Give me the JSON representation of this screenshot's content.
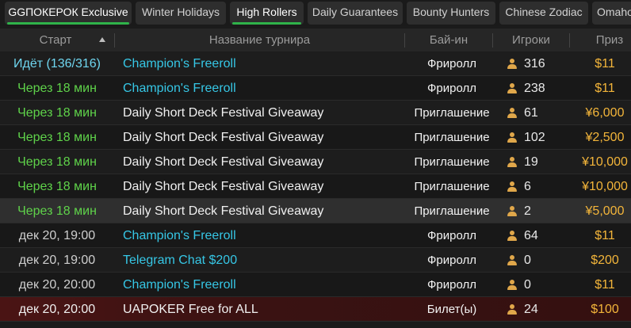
{
  "tabs": [
    {
      "label": "GGПОКЕРОК Exclusive",
      "active": true
    },
    {
      "label": "Winter Holidays",
      "active": false
    },
    {
      "label": "High Rollers",
      "active": true
    },
    {
      "label": "Daily Guarantees",
      "active": false
    },
    {
      "label": "Bounty Hunters",
      "active": false
    },
    {
      "label": "Chinese Zodiac",
      "active": false
    },
    {
      "label": "Omaho",
      "active": false
    }
  ],
  "columns": {
    "start": "Старт",
    "name": "Название турнира",
    "buyin": "Бай-ин",
    "players": "Игроки",
    "prize": "Приз"
  },
  "colors": {
    "active_tab_underline": "#2fb34a",
    "status_green": "#5fd34a",
    "name_cyan": "#36c7e6",
    "prize_gold": "#f3b53a",
    "user_icon": "#e0a74a"
  },
  "rows": [
    {
      "start": "Идёт (136/316)",
      "start_style": "live",
      "name": "Champion's Freeroll",
      "name_style": "cyan",
      "buyin": "Фриролл",
      "players": "316",
      "prize": "$11",
      "bg": "normal"
    },
    {
      "start": "Через 18 мин",
      "start_style": "green",
      "name": "Champion's Freeroll",
      "name_style": "cyan",
      "buyin": "Фриролл",
      "players": "238",
      "prize": "$11",
      "bg": "alt"
    },
    {
      "start": "Через 18 мин",
      "start_style": "green",
      "name": "Daily Short Deck Festival Giveaway",
      "name_style": "white",
      "buyin": "Приглашение",
      "players": "61",
      "prize": "¥6,000",
      "bg": "normal"
    },
    {
      "start": "Через 18 мин",
      "start_style": "green",
      "name": "Daily Short Deck Festival Giveaway",
      "name_style": "white",
      "buyin": "Приглашение",
      "players": "102",
      "prize": "¥2,500",
      "bg": "alt"
    },
    {
      "start": "Через 18 мин",
      "start_style": "green",
      "name": "Daily Short Deck Festival Giveaway",
      "name_style": "white",
      "buyin": "Приглашение",
      "players": "19",
      "prize": "¥10,000",
      "bg": "normal"
    },
    {
      "start": "Через 18 мин",
      "start_style": "green",
      "name": "Daily Short Deck Festival Giveaway",
      "name_style": "white",
      "buyin": "Приглашение",
      "players": "6",
      "prize": "¥10,000",
      "bg": "alt"
    },
    {
      "start": "Через 18 мин",
      "start_style": "green",
      "name": "Daily Short Deck Festival Giveaway",
      "name_style": "white",
      "buyin": "Приглашение",
      "players": "2",
      "prize": "¥5,000",
      "bg": "hl"
    },
    {
      "start": "дек 20, 19:00",
      "start_style": "grey",
      "name": "Champion's Freeroll",
      "name_style": "cyan",
      "buyin": "Фриролл",
      "players": "64",
      "prize": "$11",
      "bg": "alt"
    },
    {
      "start": "дек 20, 19:00",
      "start_style": "grey",
      "name": "Telegram Chat $200",
      "name_style": "cyan",
      "buyin": "Фриролл",
      "players": "0",
      "prize": "$200",
      "bg": "normal"
    },
    {
      "start": "дек 20, 20:00",
      "start_style": "grey",
      "name": "Champion's Freeroll",
      "name_style": "cyan",
      "buyin": "Фриролл",
      "players": "0",
      "prize": "$11",
      "bg": "alt"
    },
    {
      "start": "дек 20, 20:00",
      "start_style": "white",
      "name": "UAPOKER Free for ALL",
      "name_style": "white",
      "buyin": "Билет(ы)",
      "players": "24",
      "prize": "$100",
      "bg": "red"
    }
  ]
}
